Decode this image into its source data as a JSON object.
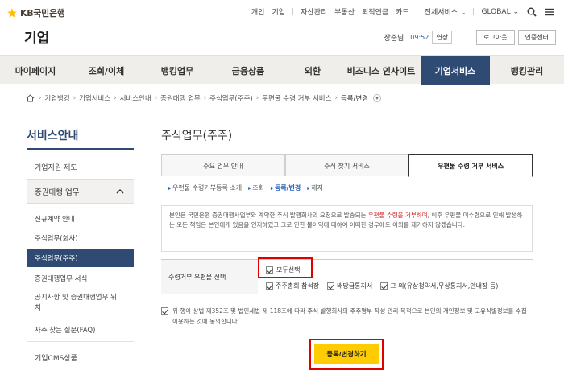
{
  "brand": {
    "logo_text": "KB국민은행",
    "page_kind": "기업",
    "logo_colors": [
      "#ffbc00",
      "#6b6158"
    ]
  },
  "topnav": {
    "group1": [
      "개인",
      "기업"
    ],
    "group2": [
      "자산관리",
      "부동산",
      "퇴직연금",
      "카드"
    ],
    "all_services": "전체서비스",
    "global": "GLOBAL"
  },
  "userbar": {
    "user": "장준님",
    "timer": "09:52",
    "extend": "연장",
    "logout": "로그아웃",
    "cert": "인증센터"
  },
  "gnb": [
    "마이페이지",
    "조회/이체",
    "뱅킹업무",
    "금융상품",
    "외환",
    "비즈니스 인사이트",
    "기업서비스",
    "뱅킹관리"
  ],
  "breadcrumb": [
    "기업뱅킹",
    "기업서비스",
    "서비스안내",
    "증권대행 업무",
    "주식업무(주주)",
    "우편물 수령 거부 서비스",
    "등록/변경"
  ],
  "lnb": {
    "title": "서비스안내",
    "item1": "기업지원 제도",
    "open": "증권대행 업무",
    "subs": [
      "신규계약 안내",
      "주식업무(회사)",
      "주식업무(주주)",
      "증권대행업무 서식",
      "공지사항 및 증권대행업무 위치",
      "자주 찾는 질문(FAQ)"
    ],
    "item_last": "기업CMS상품"
  },
  "content": {
    "title": "주식업무(주주)",
    "tabs": [
      "주요 업무 안내",
      "주식 찾기 서비스",
      "우편물 수령 거부 서비스"
    ],
    "subtabs": [
      "우편물 수령거부등록 소개",
      "조회",
      "등록/변경",
      "해지"
    ],
    "notice_pre": "본인은 국민은행 증권대행사업부와 계약한 주식 발행회사의 요청으로 발송되는 ",
    "notice_red": "우편물 수령을 거부하며",
    "notice_post": ", 이후 우편물 미수령으로 인해 발생하는 모든 책임은 본인에게 있음을 인지하였고 그로 인한 불이익에 대하여 어떠한 경우에도 이의를 제기하지 않겠습니다.",
    "opt_label": "수령거부 우편물 선택",
    "opt_all": "모두선택",
    "opts": [
      "주주총회 참석장",
      "배당금통지서",
      "그 외(유상청약서,무상통지서,안내장 등)"
    ],
    "agree": "위 행이 상법 제352조 및 법인세법 제 118조에 따라 주식 발행회사의 주주명부 작성 관리 목적으로 본인의 개인정보 및 고유식별정보를 수집 이용하는 것에 동의합니다.",
    "submit": "등록/변경하기"
  },
  "colors": {
    "brand_navy": "#2f4a73",
    "button_yellow": "#ffcc00",
    "highlight_red": "#e00000",
    "link_blue": "#2a62b8"
  }
}
